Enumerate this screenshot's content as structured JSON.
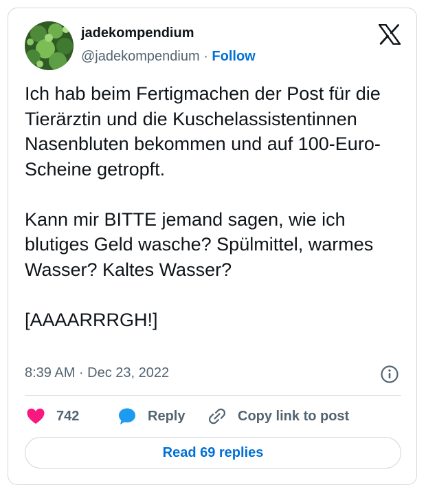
{
  "author": {
    "display_name": "jadekompendium",
    "handle": "@jadekompendium",
    "separator": "·",
    "follow_label": "Follow"
  },
  "brand_icon": "x-logo-icon",
  "tweet": {
    "paragraphs": [
      "Ich hab beim Fertigmachen der Post für die Tierärztin und die Kuschelassistentinnen Nasenbluten bekommen und auf 100-Euro-Scheine getropft.",
      "Kann mir BITTE jemand sagen, wie ich blutiges Geld wasche? Spülmittel, warmes Wasser? Kaltes Wasser?",
      "[AAAARRRGH!]"
    ],
    "timestamp": "8:39 AM · Dec 23, 2022"
  },
  "actions": {
    "like_count": "742",
    "reply_label": "Reply",
    "copy_label": "Copy link to post"
  },
  "read_replies_label": "Read 69 replies",
  "colors": {
    "like": "#f91880",
    "reply_bubble": "#1d9bf0",
    "link": "#006fd6",
    "muted_text": "#536471",
    "border": "#cfd9de"
  }
}
